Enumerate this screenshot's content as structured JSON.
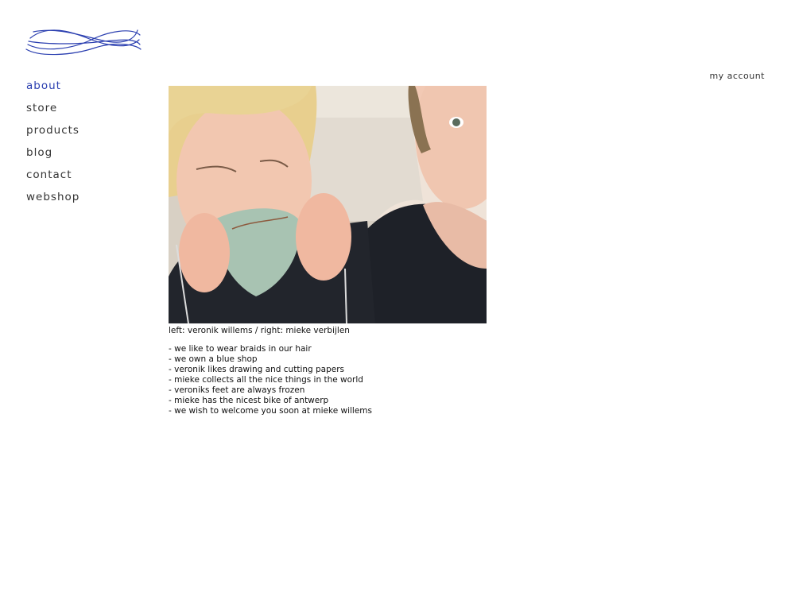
{
  "nav": {
    "items": [
      {
        "label": "about",
        "active": true
      },
      {
        "label": "store"
      },
      {
        "label": "products"
      },
      {
        "label": "blog"
      },
      {
        "label": "contact"
      },
      {
        "label": "webshop"
      }
    ]
  },
  "header": {
    "account_label": "my account"
  },
  "main": {
    "caption": "left: veronik willems / right: mieke verbijlen",
    "facts": [
      "- we like to wear braids in our hair",
      "- we own a blue shop",
      "- veronik likes drawing and cutting papers",
      "- mieke collects all the nice things in the world",
      "- veroniks feet are always frozen",
      "- mieke has the nicest bike of antwerp",
      "- we wish to welcome you soon at mieke willems"
    ]
  },
  "colors": {
    "accent": "#2b3fb0",
    "text": "#222222",
    "background": "#ffffff"
  },
  "icons": {
    "logo": "blue-thread-scribble"
  }
}
